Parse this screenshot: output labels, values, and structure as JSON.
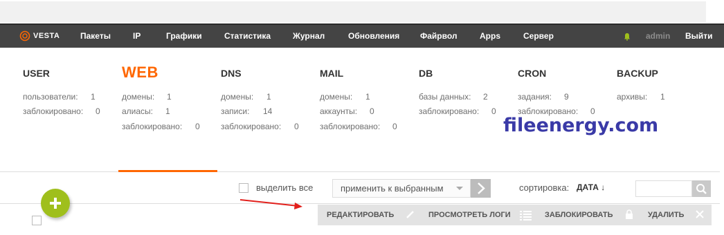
{
  "app": {
    "logo_text": "VESTA",
    "user": "admin",
    "logout": "Выйти"
  },
  "nav": [
    "Пакеты",
    "IP",
    "Графики",
    "Статистика",
    "Журнал",
    "Обновления",
    "Файрвол",
    "Apps",
    "Сервер"
  ],
  "panels": [
    {
      "title": "USER",
      "stats": [
        {
          "label": "пользователи:",
          "value": "1"
        },
        {
          "label": "заблокировано:",
          "value": "0"
        }
      ]
    },
    {
      "title": "WEB",
      "stats": [
        {
          "label": "домены:",
          "value": "1"
        },
        {
          "label": "алиасы:",
          "value": "1"
        },
        {
          "label": "заблокировано:",
          "value": "0"
        }
      ]
    },
    {
      "title": "DNS",
      "stats": [
        {
          "label": "домены:",
          "value": "1"
        },
        {
          "label": "записи:",
          "value": "14"
        },
        {
          "label": "заблокировано:",
          "value": "0"
        }
      ]
    },
    {
      "title": "MAIL",
      "stats": [
        {
          "label": "домены:",
          "value": "1"
        },
        {
          "label": "аккаунты:",
          "value": "0"
        },
        {
          "label": "заблокировано:",
          "value": "0"
        }
      ]
    },
    {
      "title": "DB",
      "stats": [
        {
          "label": "базы данных:",
          "value": "2"
        },
        {
          "label": "заблокировано:",
          "value": "0"
        }
      ]
    },
    {
      "title": "CRON",
      "stats": [
        {
          "label": "задания:",
          "value": "9"
        },
        {
          "label": "заблокировано:",
          "value": "0"
        }
      ]
    },
    {
      "title": "BACKUP",
      "stats": [
        {
          "label": "архивы:",
          "value": "1"
        }
      ]
    }
  ],
  "watermark": "fileenergy.com",
  "toolbar": {
    "select_all": "выделить все",
    "apply_selected": "применить к выбранным",
    "sort_label": "сортировка:",
    "sort_value": "ДАТА ↓"
  },
  "actions": {
    "edit": "РЕДАКТИРОВАТЬ",
    "logs": "ПРОСМОТРЕТЬ ЛОГИ",
    "suspend": "ЗАБЛОКИРОВАТЬ",
    "delete": "УДАЛИТЬ"
  },
  "colors": {
    "accent": "#ff6701",
    "nav_bg": "#444444",
    "add_button": "#9fbf1c",
    "watermark": "#3a3aa7"
  }
}
